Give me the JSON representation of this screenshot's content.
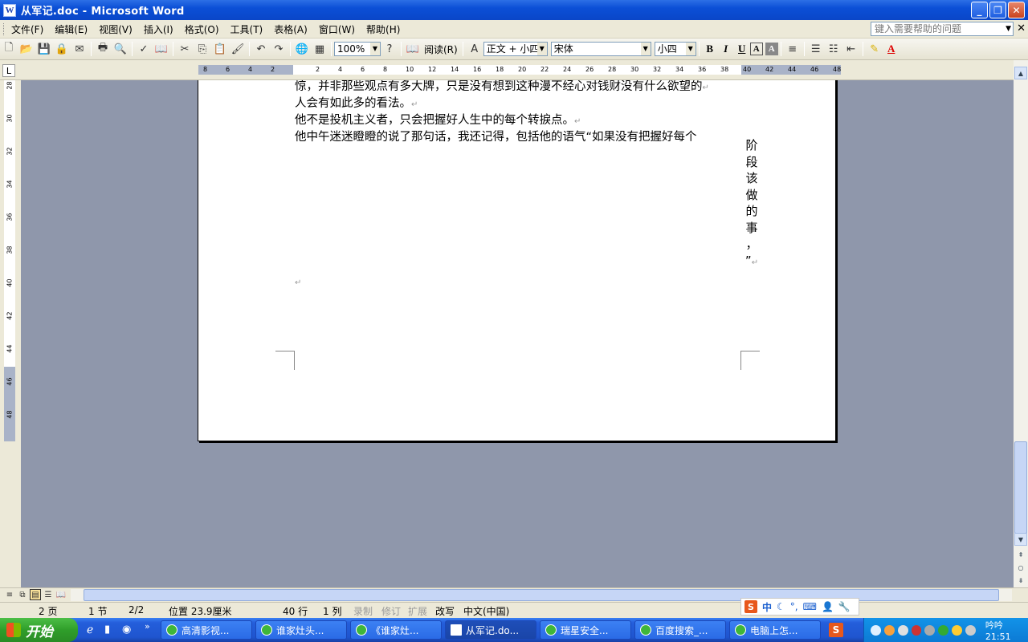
{
  "window": {
    "title": "从军记.doc - Microsoft Word",
    "icon": "word-icon"
  },
  "menu": {
    "items": [
      "文件(F)",
      "编辑(E)",
      "视图(V)",
      "插入(I)",
      "格式(O)",
      "工具(T)",
      "表格(A)",
      "窗口(W)",
      "帮助(H)"
    ],
    "help_placeholder": "键入需要帮助的问题"
  },
  "toolbar": {
    "zoom": "100%",
    "read_label": "阅读(R)",
    "style": "正文 + 小四",
    "font": "宋体",
    "size": "小四"
  },
  "ruler": {
    "h_ticks": [
      "8",
      "6",
      "4",
      "2",
      "2",
      "4",
      "6",
      "8",
      "10",
      "12",
      "14",
      "16",
      "18",
      "20",
      "22",
      "24",
      "26",
      "28",
      "30",
      "32",
      "34",
      "36",
      "38",
      "40",
      "42",
      "44",
      "46",
      "48"
    ],
    "v_ticks": [
      "28",
      "30",
      "32",
      "34",
      "36",
      "38",
      "40",
      "42",
      "44",
      "46",
      "48"
    ]
  },
  "document": {
    "lines": [
      "惊，并非那些观点有多大牌，只是没有想到这种漫不经心对钱财没有什么欲望的",
      "人会有如此多的看法。",
      "他不是投机主义者，只会把握好人生中的每个转捩点。",
      "他中午迷迷瞪瞪的说了那句话，我还记得，包括他的语气“如果没有把握好每个"
    ],
    "vertical_text": [
      "阶",
      "段",
      "该",
      "做",
      "的",
      "事",
      "，",
      "”"
    ]
  },
  "status": {
    "page": "2 页",
    "section": "1 节",
    "pages": "2/2",
    "position": "位置 23.9厘米",
    "line": "40 行",
    "column": "1 列",
    "rec": "录制",
    "trk": "修订",
    "ext": "扩展",
    "ovr": "改写",
    "lang": "中文(中国)"
  },
  "ime": {
    "logo": "S",
    "mode": "中"
  },
  "taskbar": {
    "start": "开始",
    "tasks": [
      "高清影视...",
      "谁家灶头...",
      "《谁家灶...",
      "从军记.do...",
      "瑞星安全...",
      "百度搜索_...",
      "电脑上怎..."
    ],
    "clock": "吟吟21:51"
  }
}
